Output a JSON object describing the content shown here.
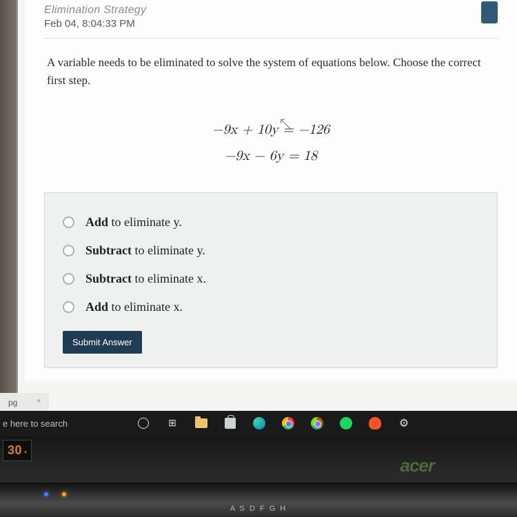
{
  "header": {
    "module_title": "Elimination Strategy",
    "timestamp": "Feb 04, 8:04:33 PM"
  },
  "question": {
    "prompt": "A variable needs to be eliminated to solve the system of equations below. Choose the correct first step.",
    "eq1": "−9x + 10y = −126",
    "eq2": "−9x − 6y = 18"
  },
  "options": [
    {
      "bold": "Add",
      "rest": " to eliminate y."
    },
    {
      "bold": "Subtract",
      "rest": " to eliminate y."
    },
    {
      "bold": "Subtract",
      "rest": " to eliminate x."
    },
    {
      "bold": "Add",
      "rest": " to eliminate x."
    }
  ],
  "buttons": {
    "submit": "Submit Answer"
  },
  "tray": {
    "ext": "pg",
    "caret": "^"
  },
  "taskbar": {
    "search_label": "e here to search"
  },
  "laptop": {
    "model": "30",
    "brand": "acer",
    "keys": "A   S   D   F   G   H"
  }
}
